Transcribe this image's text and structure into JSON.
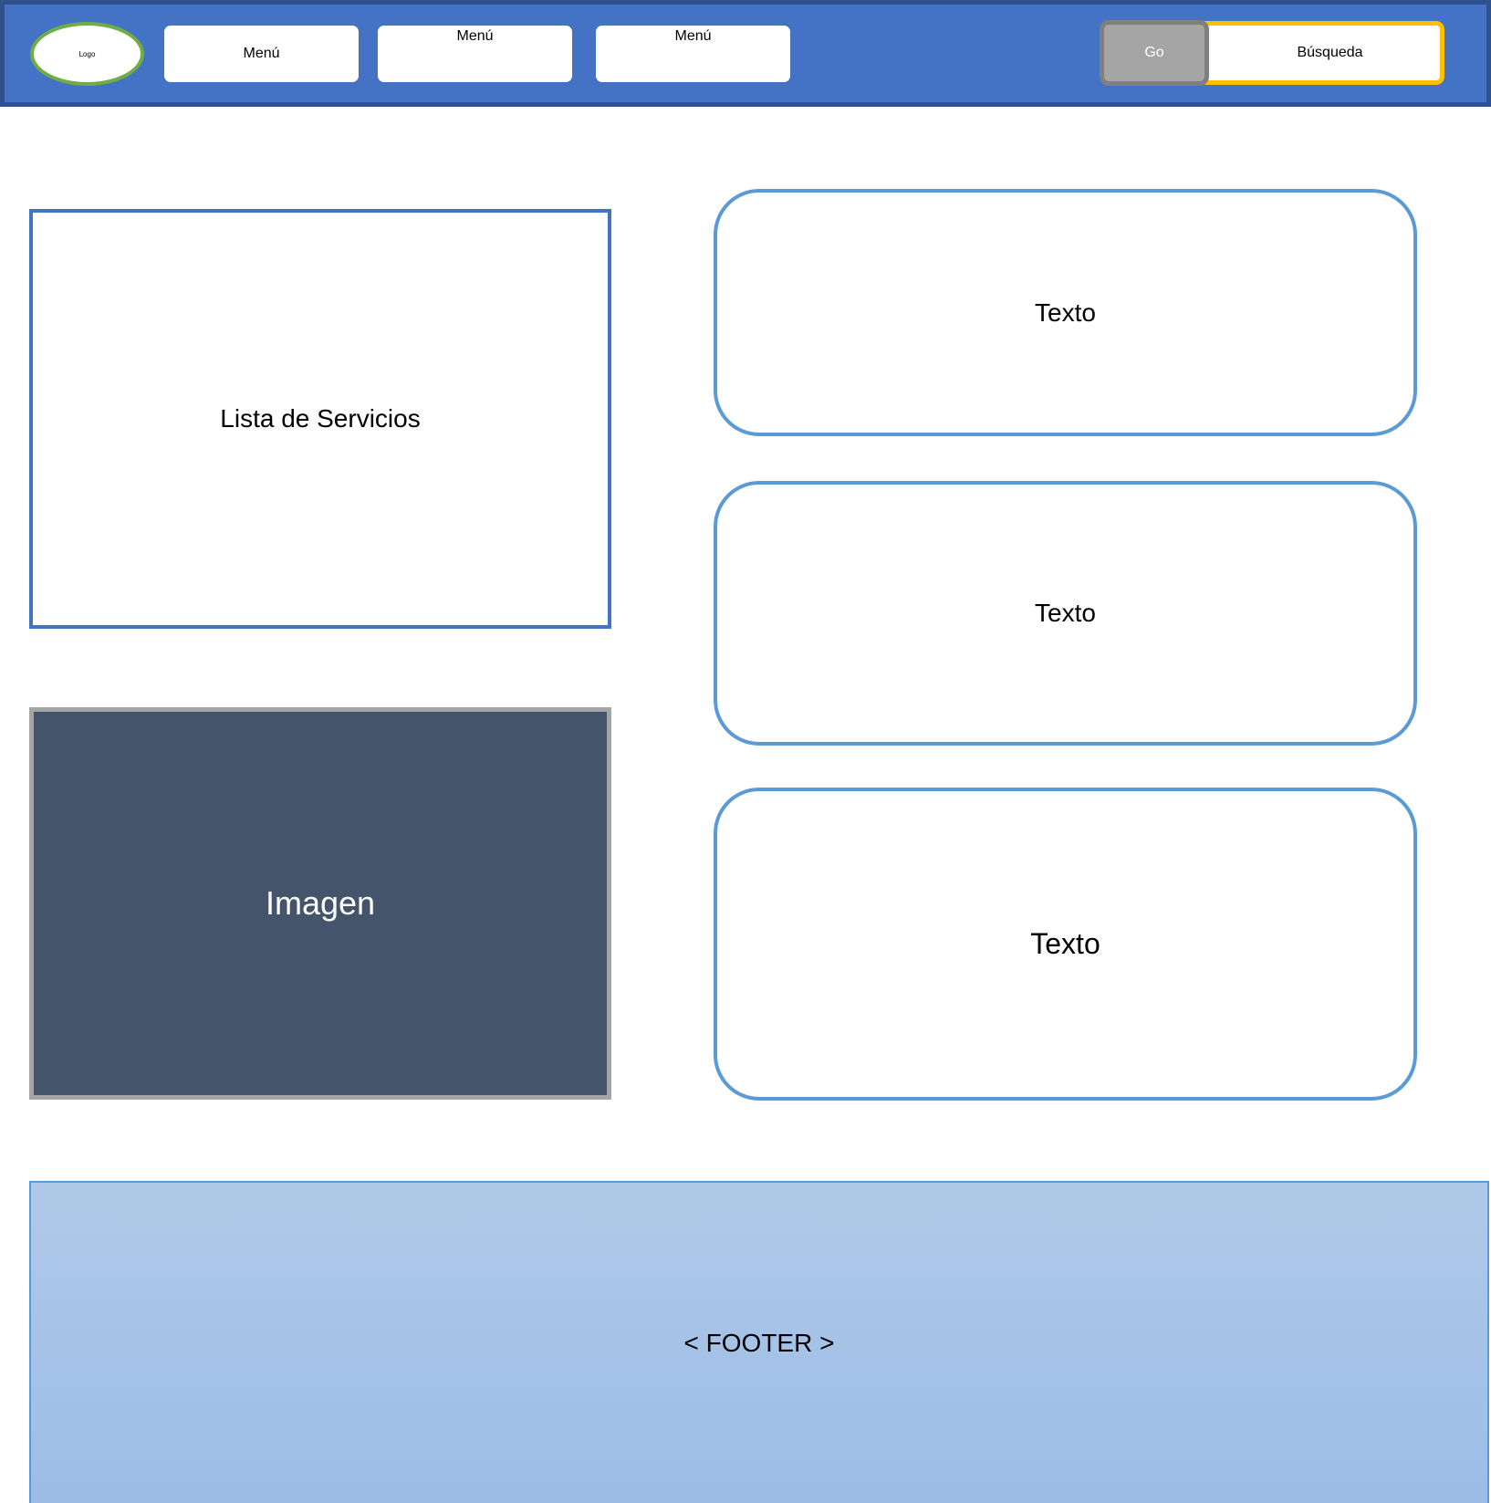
{
  "header": {
    "logo_text": "Logo",
    "menus": [
      "Menú",
      "Menú",
      "Menú"
    ],
    "go_label": "Go",
    "search_label": "Búsqueda"
  },
  "main": {
    "services_label": "Lista de Servicios",
    "image_label": "Imagen",
    "text_cards": [
      "Texto",
      "Texto",
      "Texto"
    ]
  },
  "footer": {
    "label": "< FOOTER >"
  },
  "colors": {
    "header_fill": "#4472C4",
    "logo_border": "#70AD47",
    "search_border": "#FFC000",
    "go_fill": "#A5A5A5",
    "image_fill": "#44546A",
    "card_border": "#5B9BD5",
    "footer_fill": "#9BBDE6"
  }
}
